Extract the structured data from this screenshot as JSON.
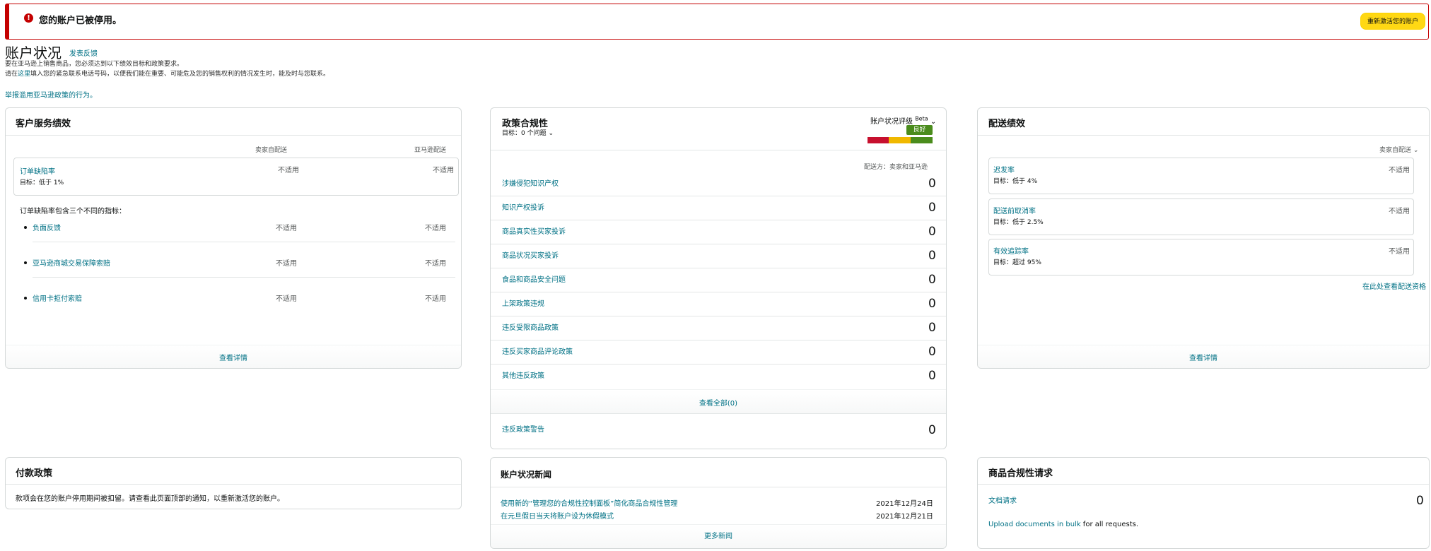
{
  "alert": {
    "icon": "alert-icon",
    "message": "您的账户已被停用。",
    "reactivate_label": "重新激活您的账户"
  },
  "header": {
    "title": "账户状况",
    "feedback_label": "发表反馈",
    "intro_1": "要在亚马逊上销售商品，您必须达到以下绩效目标和政策要求。",
    "intro_2_prefix": "请在",
    "intro_2_link": "这里",
    "intro_2_suffix": "填入您的紧急联系电话号码，以便我们能在重要、可能危及您的销售权利的情况发生时，能及时与您联系。",
    "report_link": "举报滥用亚马逊政策的行为。"
  },
  "customer_service": {
    "title": "客户服务绩效",
    "col_seller": "卖家自配送",
    "col_amazon": "亚马逊配送",
    "odr_label": "订单缺陷率",
    "odr_target": "目标：低于 1%",
    "odr_seller": "不适用",
    "odr_amazon": "不适用",
    "sub_intro": "订单缺陷率包含三个不同的指标：",
    "items": [
      {
        "label": "负面反馈",
        "seller": "不适用",
        "amazon": "不适用"
      },
      {
        "label": "亚马逊商城交易保障索赔",
        "seller": "不适用",
        "amazon": "不适用"
      },
      {
        "label": "信用卡拒付索赔",
        "seller": "不适用",
        "amazon": "不适用"
      }
    ],
    "footer": "查看详情"
  },
  "policy": {
    "title": "政策合规性",
    "target": "目标：0 个问题",
    "health_label": "账户状况评级",
    "beta": "Beta",
    "health_status": "良好",
    "colors": {
      "bad": "#c7102e",
      "fair": "#f0b800",
      "good": "#4a8c1c"
    },
    "fulfilled_by": "配送方：卖家和亚马逊",
    "rows": [
      {
        "label": "涉嫌侵犯知识产权",
        "value": "0"
      },
      {
        "label": "知识产权投诉",
        "value": "0"
      },
      {
        "label": "商品真实性买家投诉",
        "value": "0"
      },
      {
        "label": "商品状况买家投诉",
        "value": "0"
      },
      {
        "label": "食品和商品安全问题",
        "value": "0"
      },
      {
        "label": "上架政策违规",
        "value": "0"
      },
      {
        "label": "违反受限商品政策",
        "value": "0"
      },
      {
        "label": "违反买家商品评论政策",
        "value": "0"
      },
      {
        "label": "其他违反政策",
        "value": "0"
      }
    ],
    "view_all": "查看全部(0)",
    "warnings_label": "违反政策警告",
    "warnings_value": "0"
  },
  "shipping": {
    "title": "配送绩效",
    "filter": "卖家自配送",
    "metrics": [
      {
        "label": "迟发率",
        "target": "目标：低于 4%",
        "value": "不适用"
      },
      {
        "label": "配送前取消率",
        "target": "目标：低于 2.5%",
        "value": "不适用"
      },
      {
        "label": "有效追踪率",
        "target": "目标：超过 95%",
        "value": "不适用"
      }
    ],
    "eligibility_link": "在此处查看配送资格",
    "footer": "查看详情"
  },
  "payment": {
    "title": "付款政策",
    "text": "款项会在您的账户停用期间被扣留。请查看此页面顶部的通知，以重新激活您的账户。"
  },
  "news": {
    "title": "账户状况新闻",
    "items": [
      {
        "label": "使用新的“管理您的合规性控制面板”简化商品合规性管理",
        "date": "2021年12月24日"
      },
      {
        "label": "在元旦假日当天将账户设为休假模式",
        "date": "2021年12月21日"
      }
    ],
    "more": "更多新闻"
  },
  "compliance": {
    "title": "商品合规性请求",
    "doc_label": "文档请求",
    "doc_value": "0",
    "upload_link": "Upload documents in bulk",
    "upload_suffix": " for all requests."
  }
}
